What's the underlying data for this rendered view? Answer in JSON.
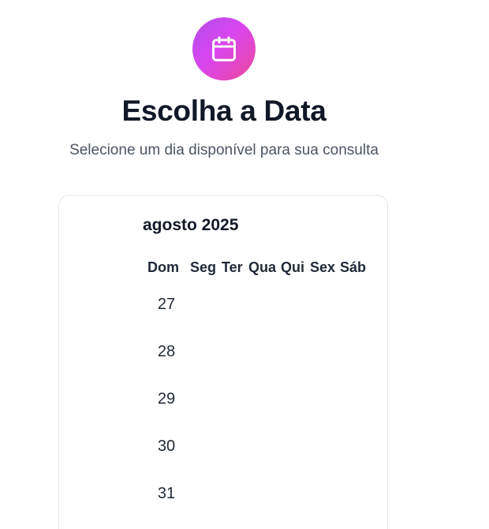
{
  "header": {
    "icon": "calendar-icon",
    "title": "Escolha a Data",
    "subtitle": "Selecione um dia disponível para sua consulta"
  },
  "calendar": {
    "month_label": "agosto 2025",
    "weekdays": [
      "Dom",
      "Seg",
      "Ter",
      "Qua",
      "Qui",
      "Sex",
      "Sáb"
    ],
    "days": [
      "27",
      "28",
      "29",
      "30",
      "31"
    ]
  },
  "colors": {
    "icon_gradient_start": "#b14ce6",
    "icon_gradient_end": "#ec4899",
    "title": "#111827",
    "subtitle": "#4b5563",
    "card_border": "#e5e7eb"
  }
}
